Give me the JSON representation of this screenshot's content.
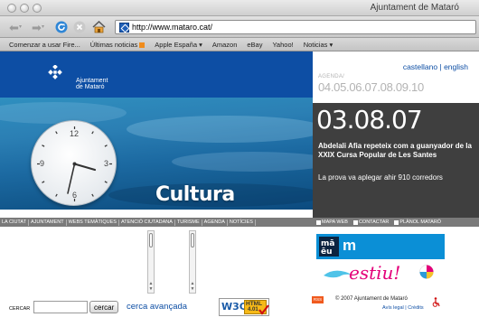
{
  "window": {
    "title": "Ajuntament de Mataró"
  },
  "toolbar": {
    "url": "http://www.mataro.cat/"
  },
  "bookmarks": [
    {
      "label": "Comenzar a usar Fire...",
      "rss": false,
      "menu": false
    },
    {
      "label": "Últimas noticias",
      "rss": true,
      "menu": false
    },
    {
      "label": "Apple España ▾",
      "rss": false,
      "menu": true
    },
    {
      "label": "Amazon",
      "rss": false,
      "menu": false
    },
    {
      "label": "eBay",
      "rss": false,
      "menu": false
    },
    {
      "label": "Yahoo!",
      "rss": false,
      "menu": false
    },
    {
      "label": "Noticias ▾",
      "rss": false,
      "menu": true
    }
  ],
  "logo": {
    "line1": "Ajuntament",
    "line2": "de Mataró"
  },
  "lang": {
    "castellano": "castellano",
    "separator": "|",
    "english": "english"
  },
  "agenda": {
    "label": "AGENDA/",
    "dates": "04.05.06.07.08.09.10"
  },
  "hero": {
    "title": "Cultura",
    "clock_numbers": [
      "12",
      "3",
      "6",
      "9"
    ]
  },
  "news": {
    "date": "03.08.07",
    "headline": "Abdelali Afia repeteix com a guanyador de la XXIX Cursa Popular de Les Santes",
    "summary": "La prova va aplegar ahir 910 corredors"
  },
  "nav": [
    "LA CIUTAT",
    "AJUNTAMENT",
    "WEBS TEMÀTIQUES",
    "ATENCIÓ CIUTADANA",
    "TURISME",
    "AGENDA",
    "NOTÍCIES"
  ],
  "util_nav": [
    {
      "label": "MAPA WEB",
      "icon": "sitemap-icon"
    },
    {
      "label": "CONTACTAR",
      "icon": "contact-icon"
    },
    {
      "label": "PLÀNOL MATARÓ",
      "icon": "map-icon"
    }
  ],
  "banners": {
    "m_logo": "mataró\nmúsica",
    "m_letter": "m",
    "estiu": "estiu!"
  },
  "search": {
    "label": "CERCAR",
    "value": "",
    "button": "cercar",
    "advanced": "cerca avançada"
  },
  "badges": {
    "w3c": "W3C",
    "html": "HTML",
    "html_version": "4.01",
    "rss": "RSS"
  },
  "footer": {
    "copyright": "© 2007 Ajuntament de Mataró",
    "legal": "Avís legal",
    "sep": "|",
    "credits": "Crèdits"
  },
  "colors": {
    "brand_blue": "#0d4ea4",
    "sidebar_dark": "#3f3f3f",
    "nav_gray": "#7a7a7a",
    "estiu_pink": "#e4007a"
  }
}
